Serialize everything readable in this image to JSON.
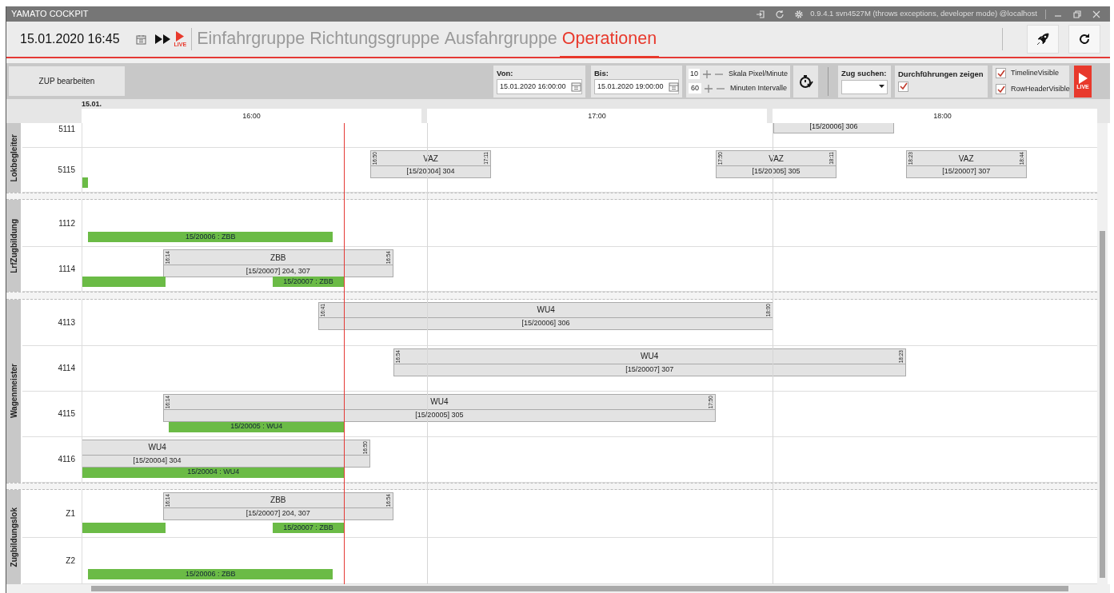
{
  "window": {
    "title": "YAMATO COCKPIT",
    "version": "0.9.4.1 svn4527M (throws exceptions, developer mode) @localhost"
  },
  "header": {
    "datetime": "15.01.2020 16:45",
    "live_label": "LIVE",
    "tabs": [
      {
        "label": "Einfahrgruppe",
        "selected": false
      },
      {
        "label": "Richtungsgruppe",
        "selected": false
      },
      {
        "label": "Ausfahrgruppe",
        "selected": false
      },
      {
        "label": "Operationen",
        "selected": true
      }
    ]
  },
  "toolbar": {
    "edit_button": "ZUP bearbeiten",
    "from": {
      "label": "Von:",
      "value": "15.01.2020 16:00:00"
    },
    "to": {
      "label": "Bis:",
      "value": "15.01.2020 19:00:00"
    },
    "scales": [
      {
        "value": "10",
        "label": "Skala Pixel/Minute"
      },
      {
        "value": "60",
        "label": "Minuten Intervalle"
      }
    ],
    "search": {
      "label": "Zug suchen:"
    },
    "executions": {
      "label": "Durchführungen zeigen",
      "checked": true
    },
    "visibility": [
      {
        "label": "TimelineVisible",
        "checked": true
      },
      {
        "label": "RowHeaderVisible",
        "checked": true
      }
    ],
    "live_label": "LIVE"
  },
  "timeline": {
    "date": "15.01.",
    "hours": [
      "16:00",
      "17:00",
      "18:00"
    ],
    "groups": [
      {
        "name": "Lokbegleiter",
        "rows": [
          {
            "label": "5111",
            "items": [
              {
                "kind": "task",
                "detail": "[15/20006] 306"
              }
            ]
          },
          {
            "label": "5115",
            "items": [
              {
                "kind": "task",
                "title": "VAZ",
                "detail": "[15/20004] 304",
                "start_label": "16:50",
                "end_label": "17:11"
              },
              {
                "kind": "task",
                "title": "VAZ",
                "detail": "[15/20005] 305",
                "start_label": "17:50",
                "end_label": "18:11"
              },
              {
                "kind": "task",
                "title": "VAZ",
                "detail": "[15/20007] 307",
                "start_label": "18:23",
                "end_label": "18:44"
              },
              {
                "kind": "progress"
              }
            ]
          }
        ]
      },
      {
        "name": "LrfZugbildung",
        "rows": [
          {
            "label": "1112",
            "items": [
              {
                "kind": "progress",
                "text": "15/20006 : ZBB"
              }
            ]
          },
          {
            "label": "1114",
            "items": [
              {
                "kind": "task",
                "title": "ZBB",
                "detail": "[15/20007] 204, 307",
                "start_label": "16:14",
                "end_label": "16:54"
              },
              {
                "kind": "progress"
              },
              {
                "kind": "progress",
                "text": "15/20007 : ZBB"
              }
            ]
          }
        ]
      },
      {
        "name": "Wagenmeister",
        "rows": [
          {
            "label": "4113",
            "items": [
              {
                "kind": "task",
                "title": "WU4",
                "detail": "[15/20006] 306",
                "start_label": "16:41",
                "end_label": "18:00"
              }
            ]
          },
          {
            "label": "4114",
            "items": [
              {
                "kind": "task",
                "title": "WU4",
                "detail": "[15/20007] 307",
                "start_label": "16:54",
                "end_label": "18:23"
              }
            ]
          },
          {
            "label": "4115",
            "items": [
              {
                "kind": "task",
                "title": "WU4",
                "detail": "[15/20005] 305",
                "start_label": "16:14",
                "end_label": "17:50"
              },
              {
                "kind": "progress",
                "text": "15/20005 : WU4"
              }
            ]
          },
          {
            "label": "4116",
            "items": [
              {
                "kind": "task",
                "title": "WU4",
                "detail": "[15/20004] 304",
                "end_label": "16:50"
              },
              {
                "kind": "progress",
                "text": "15/20004 : WU4"
              }
            ]
          }
        ]
      },
      {
        "name": "Zugbildungslok",
        "rows": [
          {
            "label": "Z1",
            "items": [
              {
                "kind": "task",
                "title": "ZBB",
                "detail": "[15/20007] 204, 307",
                "start_label": "16:14",
                "end_label": "16:54"
              },
              {
                "kind": "progress"
              },
              {
                "kind": "progress",
                "text": "15/20007 : ZBB"
              }
            ]
          },
          {
            "label": "Z2",
            "items": [
              {
                "kind": "progress",
                "text": "15/20006 : ZBB"
              }
            ]
          }
        ]
      }
    ]
  }
}
